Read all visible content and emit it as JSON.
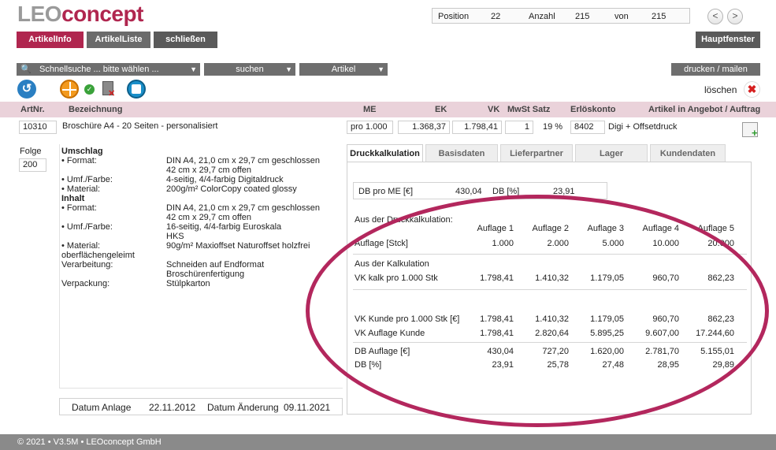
{
  "brand": {
    "part1": "LEO",
    "part2": "concept",
    "accent": "#b0264f"
  },
  "pager": {
    "position_label": "Position",
    "position": "22",
    "count_label": "Anzahl",
    "count": "215",
    "of_label": "von",
    "of": "215",
    "prev": "<",
    "next": ">"
  },
  "tabs": {
    "artikelinfo": "ArtikelInfo",
    "artikelliste": "ArtikelListe",
    "schliessen": "schließen",
    "hauptfenster": "Hauptfenster"
  },
  "toolbar": {
    "quicksearch": "Schnellsuche ... bitte wählen ...",
    "search": "suchen",
    "type": "Artikel",
    "print": "drucken / mailen",
    "delete": "löschen"
  },
  "columns": {
    "artnr": "ArtNr.",
    "bezeichnung": "Bezeichnung",
    "me": "ME",
    "ek": "EK",
    "vk": "VK",
    "mwst": "MwSt Satz",
    "konto": "Erlöskonto",
    "angebot": "Artikel in Angebot / Auftrag"
  },
  "article": {
    "artnr": "10310",
    "bezeichnung": "Broschüre A4 - 20 Seiten - personalisiert",
    "me": "pro 1.000",
    "ek": "1.368,37",
    "vk": "1.798,41",
    "mwst_code": "1",
    "mwst_pct": "19 %",
    "konto": "8402",
    "konto_name": "Digi + Offsetdruck"
  },
  "folge": {
    "label": "Folge",
    "value": "200"
  },
  "description": [
    {
      "k": "Umschlag",
      "v": "",
      "head": true
    },
    {
      "k": "• Format:",
      "v": "DIN A4, 21,0 cm x 29,7 cm geschlossen"
    },
    {
      "k": "",
      "v": "42 cm x 29,7 cm offen"
    },
    {
      "k": "• Umf./Farbe:",
      "v": "4-seitig, 4/4-farbig Digitaldruck"
    },
    {
      "k": "• Material:",
      "v": "200g/m² ColorCopy coated glossy"
    },
    {
      "k": "Inhalt",
      "v": "",
      "head": true
    },
    {
      "k": "• Format:",
      "v": "DIN A4, 21,0 cm x 29,7 cm geschlossen"
    },
    {
      "k": "",
      "v": "42 cm x 29,7 cm offen"
    },
    {
      "k": "• Umf./Farbe:",
      "v": "16-seitig, 4/4-farbig Euroskala"
    },
    {
      "k": "",
      "v": "HKS"
    },
    {
      "k": "• Material:",
      "v": "90g/m² Maxioffset Naturoffset holzfrei"
    },
    {
      "k": "oberflächengeleimt",
      "v": ""
    },
    {
      "k": "Verarbeitung:",
      "v": "Schneiden auf Endformat"
    },
    {
      "k": "",
      "v": "Broschürenfertigung"
    },
    {
      "k": "Verpackung:",
      "v": "Stülpkarton"
    }
  ],
  "dates": {
    "anlage_label": "Datum Anlage",
    "anlage": "22.11.2012",
    "aenderung_label": "Datum Änderung",
    "aenderung": "09.11.2021"
  },
  "right_tabs": [
    "Druckkalkulation",
    "Basisdaten",
    "Lieferpartner",
    "Lager",
    "Kundendaten"
  ],
  "db": {
    "label": "DB pro ME [€]",
    "value": "430,04",
    "pct_label": "DB [%]",
    "pct": "23,91"
  },
  "calc": {
    "section": "Aus der Druckkalkulation:",
    "headers": [
      "Auflage 1",
      "Auflage 2",
      "Auflage 3",
      "Auflage 4",
      "Auflage 5"
    ],
    "auflage": {
      "label": "Auflage [Stck]",
      "values": [
        "1.000",
        "2.000",
        "5.000",
        "10.000",
        "20.000"
      ]
    },
    "kalk_section": "Aus der Kalkulation",
    "vk_kalk": {
      "label": "VK kalk pro 1.000 Stk",
      "values": [
        "1.798,41",
        "1.410,32",
        "1.179,05",
        "960,70",
        "862,23"
      ]
    },
    "vk_kunde": {
      "label": "VK Kunde pro 1.000 Stk [€]",
      "values": [
        "1.798,41",
        "1.410,32",
        "1.179,05",
        "960,70",
        "862,23"
      ]
    },
    "vk_auflage": {
      "label": "VK Auflage Kunde",
      "values": [
        "1.798,41",
        "2.820,64",
        "5.895,25",
        "9.607,00",
        "17.244,60"
      ]
    },
    "db_auflage": {
      "label": "DB Auflage [€]",
      "values": [
        "430,04",
        "727,20",
        "1.620,00",
        "2.781,70",
        "5.155,01"
      ]
    },
    "db_pct": {
      "label": "DB [%]",
      "values": [
        "23,91",
        "25,78",
        "27,48",
        "28,95",
        "29,89"
      ]
    }
  },
  "footer": "© 2021 • V3.5M • LEOconcept GmbH"
}
